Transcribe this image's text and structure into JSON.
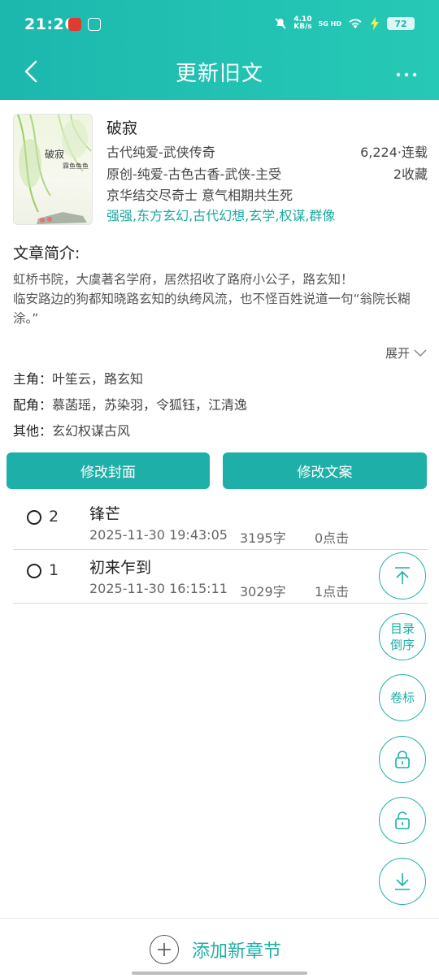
{
  "status_bar": {
    "time": "21:26",
    "net_speed_value": "4.10",
    "net_speed_unit": "KB/s",
    "network": "5G HD",
    "battery": "72"
  },
  "header": {
    "title": "更新旧文",
    "back_icon": "chevron-left-icon",
    "more_icon": "more-horizontal-icon"
  },
  "book": {
    "name": "破寂",
    "cover_title": "破寂",
    "cover_author": "霖鱼鱼鱼",
    "genre": "古代纯爱-武侠传奇",
    "word_status": "6,224·连载",
    "category": "原创-纯爱-古色古香-武侠-主受",
    "favorites": "2收藏",
    "tagline": "京华结交尽奇士 意气相期共生死",
    "tags": "强强,东方玄幻,古代幻想,玄学,权谋,群像"
  },
  "intro": {
    "label": "文章简介:",
    "text_line1": "虹桥书院，大虞著名学府，居然招收了路府小公子，路玄知！",
    "text_line2": "临安路边的狗都知晓路玄知的纨绔风流，也不怪百姓说道一句“翁院长糊涂。”",
    "expand_label": "展开"
  },
  "roles": [
    {
      "key": "主角：",
      "value": "叶笙云，路玄知"
    },
    {
      "key": "配角：",
      "value": "慕菡瑶，苏染羽，令狐钰，江清逸"
    },
    {
      "key": "其他：",
      "value": "玄幻权谋古风"
    }
  ],
  "actions": {
    "edit_cover": "修改封面",
    "edit_copy": "修改文案"
  },
  "chapters": [
    {
      "num": "2",
      "title": "锋芒",
      "date": "2025-11-30 19:43:05",
      "words": "3195字",
      "clicks": "0点击"
    },
    {
      "num": "1",
      "title": "初来乍到",
      "date": "2025-11-30 16:15:11",
      "words": "3029字",
      "clicks": "1点击"
    }
  ],
  "fabs": {
    "reverse_label": "目录倒序",
    "volume_label": "卷标"
  },
  "bottom": {
    "add_label": "添加新章节"
  },
  "colors": {
    "accent": "#1eb0a8",
    "header_gradient_start": "#1cb7ad",
    "header_gradient_end": "#26c9b5"
  }
}
